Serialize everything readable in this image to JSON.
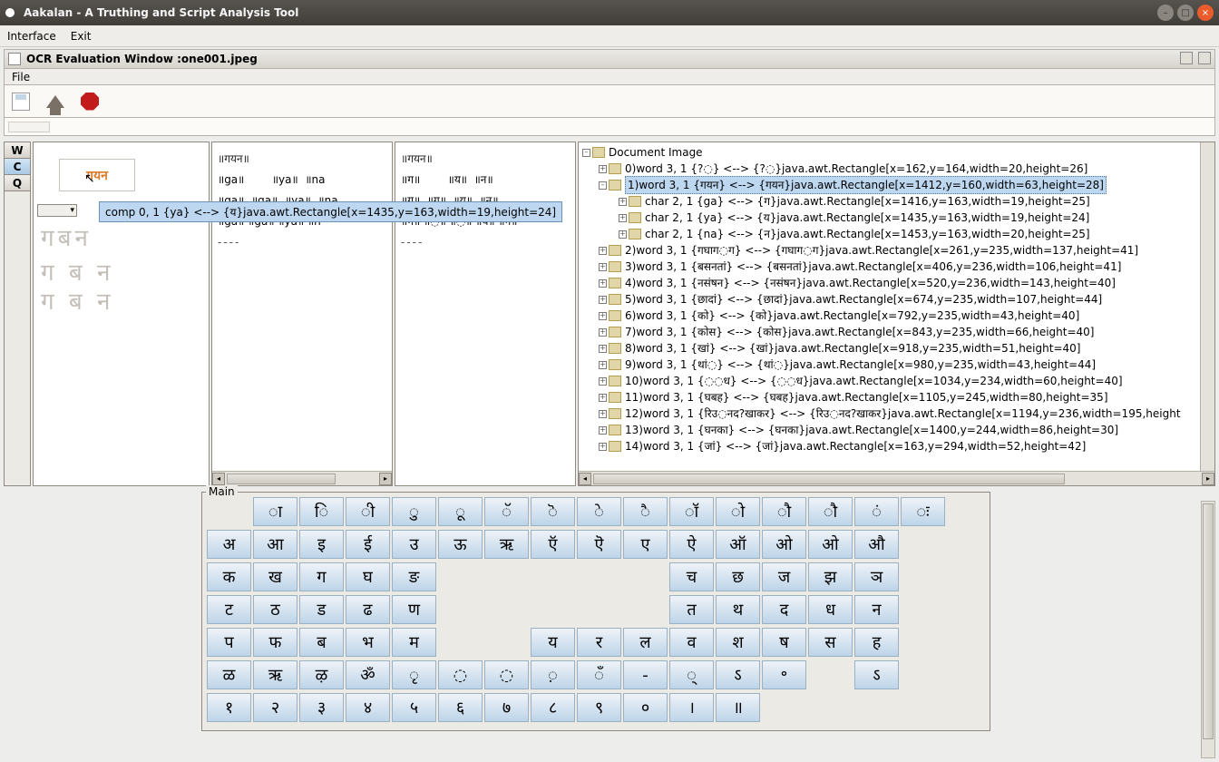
{
  "titlebar": {
    "title": "Aakalan - A Truthing and Script Analysis Tool"
  },
  "menu": {
    "interface": "Interface",
    "exit": "Exit"
  },
  "subwin": {
    "title": "OCR Evaluation Window :one001.jpeg",
    "file": "File"
  },
  "lefttoggles": {
    "w": "W",
    "c": "C",
    "q": "Q"
  },
  "tooltip": "comp 0, 1 {ya} <--> {य}java.awt.Rectangle[x=1435,y=163,width=19,height=24]",
  "midtext": {
    "l1": "॥गयन॥",
    "l2": "॥ga॥        ॥ya॥  ॥na",
    "l3": "॥ga॥  ॥ga॥  ॥ya॥  ॥na",
    "l4": "॥ga॥ ॥ga॥ ॥ya॥ ॥n",
    "l5": "----"
  },
  "righttext": {
    "l1": "॥गयन॥",
    "l2": "॥ग॥        ॥य॥  ॥न॥",
    "l3": "॥ग॥  ॥ग॥  ॥य॥  ॥न॥",
    "l4": "॥ग॥ ॥◌॥ ॥◌॥ ॥य॥ ॥न॥",
    "l5": "----"
  },
  "tree": {
    "root": "Document Image",
    "nodes": [
      "0)word 3, 1 {?◌} <--> {?◌}java.awt.Rectangle[x=162,y=164,width=20,height=26]",
      "1)word 3, 1 {गयन} <--> {गयन}java.awt.Rectangle[x=1412,y=160,width=63,height=28]",
      "char 2, 1 {ga} <--> {ग}java.awt.Rectangle[x=1416,y=163,width=19,height=25]",
      "char 2, 1 {ya} <--> {य}java.awt.Rectangle[x=1435,y=163,width=19,height=24]",
      "char 2, 1 {na} <--> {न}java.awt.Rectangle[x=1453,y=163,width=20,height=25]",
      "2)word 3, 1 {गघाग◌ग} <--> {गघाग◌ग}java.awt.Rectangle[x=261,y=235,width=137,height=41]",
      "3)word 3, 1 {बसनतां} <--> {बसनतां}java.awt.Rectangle[x=406,y=236,width=106,height=41]",
      "4)word 3, 1 {नसंषन} <--> {नसंषन}java.awt.Rectangle[x=520,y=236,width=143,height=40]",
      "5)word 3, 1 {छादां} <--> {छादां}java.awt.Rectangle[x=674,y=235,width=107,height=44]",
      "6)word 3, 1 {को} <--> {को}java.awt.Rectangle[x=792,y=235,width=43,height=40]",
      "7)word 3, 1 {कोस} <--> {कोस}java.awt.Rectangle[x=843,y=235,width=66,height=40]",
      "8)word 3, 1 {खां} <--> {खां}java.awt.Rectangle[x=918,y=235,width=51,height=40]",
      "9)word 3, 1 {थां◌} <--> {थां◌}java.awt.Rectangle[x=980,y=235,width=43,height=44]",
      "10)word 3, 1 {◌◌ध} <--> {◌◌ध}java.awt.Rectangle[x=1034,y=234,width=60,height=40]",
      "11)word 3, 1 {घबह} <--> {घबह}java.awt.Rectangle[x=1105,y=245,width=80,height=35]",
      "12)word 3, 1 {रिउ◌नद?खाकर} <--> {रिउ◌नद?खाकर}java.awt.Rectangle[x=1194,y=236,width=195,height",
      "13)word 3, 1 {घनका} <--> {घनका}java.awt.Rectangle[x=1400,y=244,width=86,height=30]",
      "14)word 3, 1 {जां} <--> {जां}java.awt.Rectangle[x=163,y=294,width=52,height=42]"
    ]
  },
  "keyboard": {
    "legend": "Main",
    "row0": [
      "ा",
      "ि",
      "ी",
      "ु",
      "ू",
      "ॅ",
      "ॆ",
      "े",
      "ै",
      "ॉ",
      "ो",
      "ौ",
      "ौ",
      "ं",
      "ः"
    ],
    "row1": [
      "अ",
      "आ",
      "इ",
      "ई",
      "उ",
      "ऊ",
      "ऋ",
      "ऍ",
      "ऎ",
      "ए",
      "ऐ",
      "ऑ",
      "ओ",
      "ओ",
      "औ"
    ],
    "row2": [
      "क",
      "ख",
      "ग",
      "घ",
      "ङ",
      "",
      "",
      "",
      "",
      "",
      "च",
      "छ",
      "ज",
      "झ",
      "ञ"
    ],
    "row3": [
      "ट",
      "ठ",
      "ड",
      "ढ",
      "ण",
      "",
      "",
      "",
      "",
      "",
      "त",
      "थ",
      "द",
      "ध",
      "न"
    ],
    "row4": [
      "प",
      "फ",
      "ब",
      "भ",
      "म",
      "",
      "",
      "य",
      "र",
      "ल",
      "व",
      "श",
      "ष",
      "स",
      "ह"
    ],
    "row5": [
      "ळ",
      "ऋ",
      "ऴ",
      "ॐ",
      "ृ",
      "◌",
      "◌",
      "़",
      "ँ",
      "-",
      "्",
      "ऽ",
      "॰",
      "",
      "ऽ"
    ],
    "row6": [
      "१",
      "२",
      "३",
      "४",
      "५",
      "६",
      "७",
      "८",
      "९",
      "०",
      "।",
      "॥"
    ]
  }
}
